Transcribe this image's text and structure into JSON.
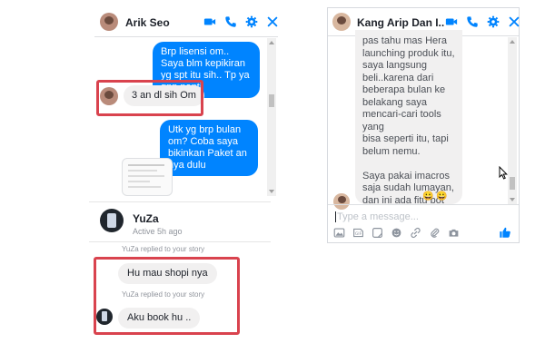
{
  "left_chat": {
    "contact_name": "Arik Seo",
    "messages": [
      {
        "text": "Brp lisensi om.. Saya blm kepikiran yg spt itu sih.. Tp ya gpp nanti"
      },
      {
        "text": "3 an dl sih Om"
      },
      {
        "text": "Utk yg brp bulan om? Coba saya bikinkan Paket an nya dulu"
      }
    ]
  },
  "story_chat": {
    "contact_name": "YuZa",
    "status": "Active 5h ago",
    "reply_label_1": "YuZa replied to your story",
    "message_1": "Hu mau shopi nya",
    "reply_label_2": "YuZa replied to your story",
    "message_2": "Aku book hu .."
  },
  "right_chat": {
    "contact_name": "Kang Arip Dan I...",
    "message_text": "pas tahu mas Hera\nlaunching produk itu,\nsaya langsung\nbeli..karena dari\nbeberapa bulan ke\nbelakang saya\nmencari-cari tools yang\nbisa seperti itu, tapi\nbelum nemu.\n\nSaya pakai imacros\nsaja sudah lumayan,\ndan ini ada fitu bot\nkirim pesan yang\nmembuat saya\nlangsung beli..",
    "composer_placeholder": "Type a message...",
    "emoji_glyphs": "😀 😀"
  },
  "colors": {
    "messenger_blue": "#0084ff",
    "highlight_red": "#d9434e",
    "incoming_bubble": "#f1f0f0"
  },
  "icons": [
    "video-icon",
    "phone-icon",
    "gear-icon",
    "close-icon",
    "image-icon",
    "gif-icon",
    "sticker-icon",
    "emoji-icon",
    "link-icon",
    "attachment-icon",
    "camera-icon",
    "like-icon"
  ]
}
